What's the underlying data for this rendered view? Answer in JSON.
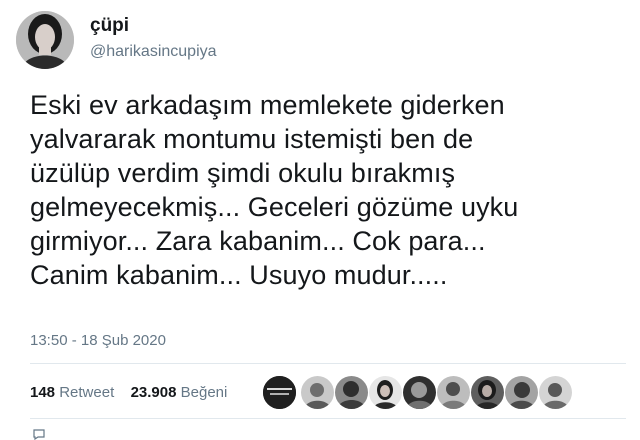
{
  "user": {
    "display_name": "çüpi",
    "handle": "@harikasincupiya"
  },
  "tweet": {
    "lines": [
      "Eski ev arkadaşım memlekete giderken",
      "yalvararak montumu istemişti ben de",
      "üzülüp verdim şimdi okulu bırakmış",
      "gelmeyecekmiş... Geceleri gözüme uyku",
      "girmiyor... Zara kabanim... Cok para...",
      "Canim kabanim... Usuyo mudur....."
    ],
    "timestamp": "13:50 - 18 Şub 2020"
  },
  "stats": {
    "retweet_count": "148",
    "retweet_label": "Retweet",
    "like_count": "23.908",
    "like_label": "Beğeni"
  },
  "likers": {
    "count_shown": 9,
    "icons": [
      "brand-avatar",
      "user-avatar",
      "user-avatar",
      "user-avatar",
      "user-avatar",
      "user-avatar",
      "user-avatar",
      "user-avatar",
      "user-avatar"
    ]
  },
  "colors": {
    "text_primary": "#14171a",
    "text_secondary": "#657786",
    "divider": "#e1e8ed"
  }
}
